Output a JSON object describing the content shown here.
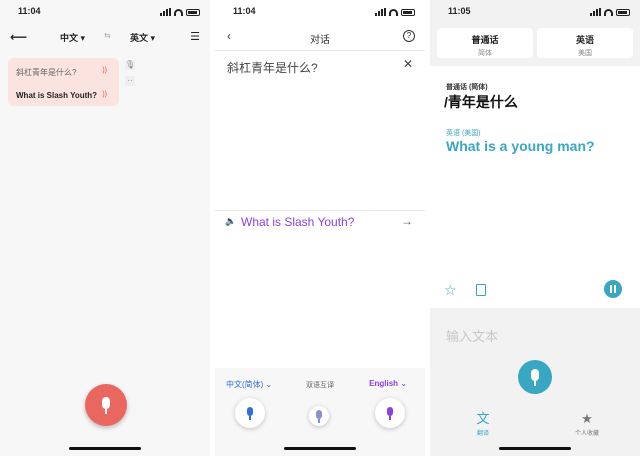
{
  "colors": {
    "coral": "#e9675f",
    "purple": "#8a3fe0",
    "blue": "#2f6fd8",
    "teal": "#3aa7c2"
  },
  "panel1": {
    "status_time": "11:04",
    "back_icon": "back-arrow-icon",
    "source_lang": "中文 ▾",
    "swap_label": "⇆",
    "target_lang": "英文 ▾",
    "settings_icon": "settings-sliders-icon",
    "source_text": "斜杠青年是什么?",
    "target_text": "What is Slash Youth?",
    "speaker_glyph": "))",
    "side_icon_1": "microphone-small-icon",
    "side_icon_2": "more-dots-icon",
    "side_glyph_1": "🎙",
    "side_glyph_2": "··",
    "mic_icon": "microphone-icon"
  },
  "panel2": {
    "status_time": "11:04",
    "back_glyph": "‹",
    "title": "对话",
    "help_glyph": "?",
    "source_text": "斜杠青年是什么?",
    "clear_glyph": "✕",
    "speaker_glyph": "🔈",
    "target_text": "What is Slash Youth?",
    "arrow_glyph": "→",
    "source_lang": "中文(简体) ⌄",
    "mode_label": "双语互译",
    "target_lang": "English ⌄"
  },
  "panel3": {
    "status_time": "11:05",
    "tab_source_name": "普通话",
    "tab_source_sub": "简体",
    "tab_target_name": "英语",
    "tab_target_sub": "美国",
    "source_label": "普通话 (简体)",
    "source_text": "/青年是什么",
    "target_label": "英语 (美国)",
    "target_text": "What is a young man?",
    "star_glyph": "☆",
    "input_placeholder": "输入文本",
    "nav_translate_label": "翻译",
    "nav_translate_glyph": "文",
    "nav_favorites_label": "个人收藏",
    "nav_favorites_glyph": "★"
  }
}
